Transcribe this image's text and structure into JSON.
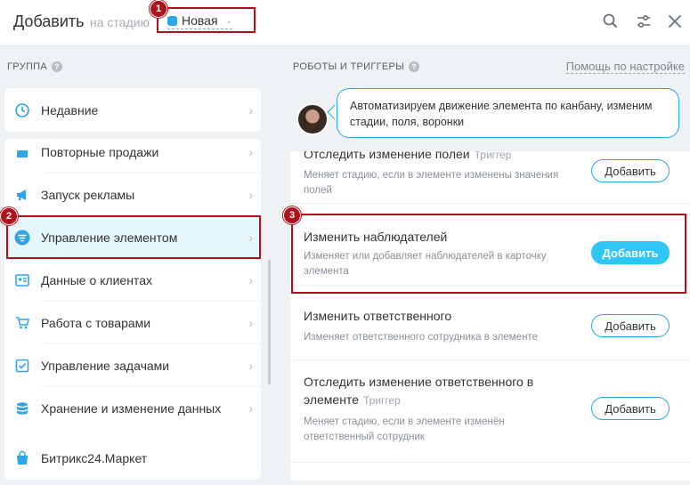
{
  "header": {
    "title": "Добавить",
    "at_stage": "на стадию",
    "stage_name": "Новая",
    "stage_caret": "⌄",
    "stage_color": "#2fa4e7"
  },
  "badges": {
    "b1": "1",
    "b2": "2",
    "b3": "3"
  },
  "left": {
    "section_title": "ГРУППА",
    "help": "?",
    "arrow": "›",
    "items": [
      {
        "label": "Недавние",
        "icon": "history-icon"
      },
      {
        "label": "Повторные продажи",
        "icon": "repeat-sales-icon"
      },
      {
        "label": "Запуск рекламы",
        "icon": "megaphone-icon"
      },
      {
        "label": "Управление элементом",
        "icon": "filter-icon"
      },
      {
        "label": "Данные о клиентах",
        "icon": "contact-card-icon"
      },
      {
        "label": "Работа с товарами",
        "icon": "cart-icon"
      },
      {
        "label": "Управление задачами",
        "icon": "task-check-icon"
      },
      {
        "label": "Хранение и изменение данных",
        "icon": "database-icon"
      }
    ],
    "market": {
      "label": "Битрикс24.Маркет",
      "icon": "market-bag-icon"
    }
  },
  "right": {
    "section_title": "РОБОТЫ И ТРИГГЕРЫ",
    "help": "?",
    "help_link": "Помощь по настройке",
    "bubble": "Автоматизируем движение элемента по канбану, изменим стадии, поля, воронки",
    "items": [
      {
        "title": "Отследить изменение полей",
        "tag": "Триггер",
        "desc": "Меняет стадию, если в элементе изменены значения полей",
        "button": "Добавить"
      },
      {
        "title": "Изменить наблюдателей",
        "tag": "",
        "desc": "Изменяет или добавляет наблюдателей в карточку элемента",
        "button": "Добавить"
      },
      {
        "title": "Изменить ответственного",
        "tag": "",
        "desc": "Изменяет ответственного сотрудника в элементе",
        "button": "Добавить"
      },
      {
        "title": "Отследить изменение ответственного в элементе",
        "tag": "Триггер",
        "desc": "Меняет стадию, если в элементе изменён ответственный сотрудник",
        "button": "Добавить"
      }
    ]
  }
}
